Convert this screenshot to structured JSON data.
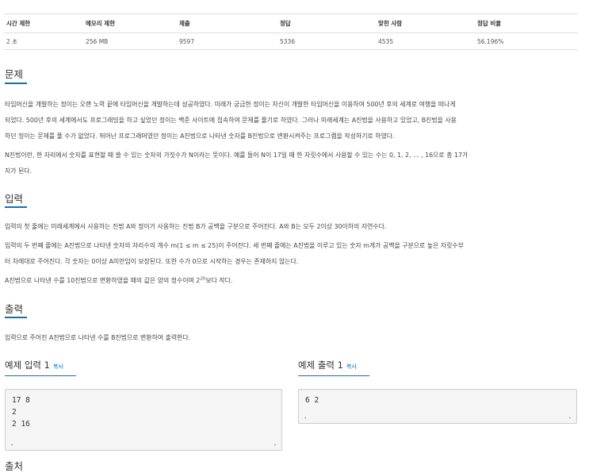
{
  "info_table": {
    "headers": [
      "시간 제한",
      "메모리 제한",
      "제출",
      "정답",
      "맞힌 사람",
      "정답 비율"
    ],
    "values": [
      "2 초",
      "256 MB",
      "9597",
      "5336",
      "4535",
      "56.196%"
    ]
  },
  "problem": {
    "heading": "문제",
    "p1_lines": [
      "타임머신을 개발하는 정이는 오랜 노력 끝에 타임머신을 개발하는데 성공하였다. 미래가 궁금한 정이는 자신이 개발한 타임머신을 이용하여 500년 후의 세계로 여행을 떠나게",
      "되었다. 500년 후의 세계에서도 프로그래밍을 하고 싶었던 정이는 백준 사이트에 접속하여 문제를 풀기로 하였다. 그러나 미래세계는 A진법을 사용하고 있었고, B진법을 사용",
      "하던 정이는 문제를 풀 수가 없었다. 뛰어난 프로그래머였던 정이는 A진법으로 나타낸 숫자를 B진법으로 변환시켜주는 프로그램을 작성하기로 하였다."
    ],
    "p2_lines": [
      "N진법이란, 한 자리에서 숫자를 표현할 때 쓸 수 있는 숫자의 가짓수가 N이라는 뜻이다. 예를 들어 N이 17일 때 한 자릿수에서 사용할 수 있는 수는 0, 1, 2, ... , 16으로 총 17가",
      "지가 된다."
    ]
  },
  "input": {
    "heading": "입력",
    "p1": "입력의 첫 줄에는 미래세계에서 사용하는 진법 A와 정이가 사용하는 진법 B가 공백을 구분으로 주어진다. A와 B는 모두 2이상 30이하의 자연수다.",
    "p2_lines": [
      "입력의 두 번째 줄에는 A진법으로 나타낸 숫자의 자리수의 개수 m(1 ≤ m ≤ 25)이 주어진다. 세 번째 줄에는 A진법을 이루고 있는 숫자 m개가 공백을 구분으로 높은 자릿수부",
      "터 차례대로 주어진다. 각 숫자는 0이상 A미만임이 보장된다. 또한 수가 0으로 시작하는 경우는 존재하지 않는다."
    ],
    "p3_before": "A진법으로 나타낸 수를 10진법으로 변환하였을 때의 값은 양의 정수이며 2",
    "p3_sup": "20",
    "p3_after": "보다 작다."
  },
  "output": {
    "heading": "출력",
    "p1": "입력으로 주어진 A진법으로 나타낸 수를 B진법으로 변환하여 출력한다."
  },
  "sample_input": {
    "title": "예제 입력 1",
    "copy": "복사",
    "content": "17 8\n2\n2 16"
  },
  "sample_output": {
    "title": "예제 출력 1",
    "copy": "복사",
    "content": "6 2"
  },
  "next_heading": "출처",
  "scroll_left": "◂",
  "scroll_right": "▸"
}
